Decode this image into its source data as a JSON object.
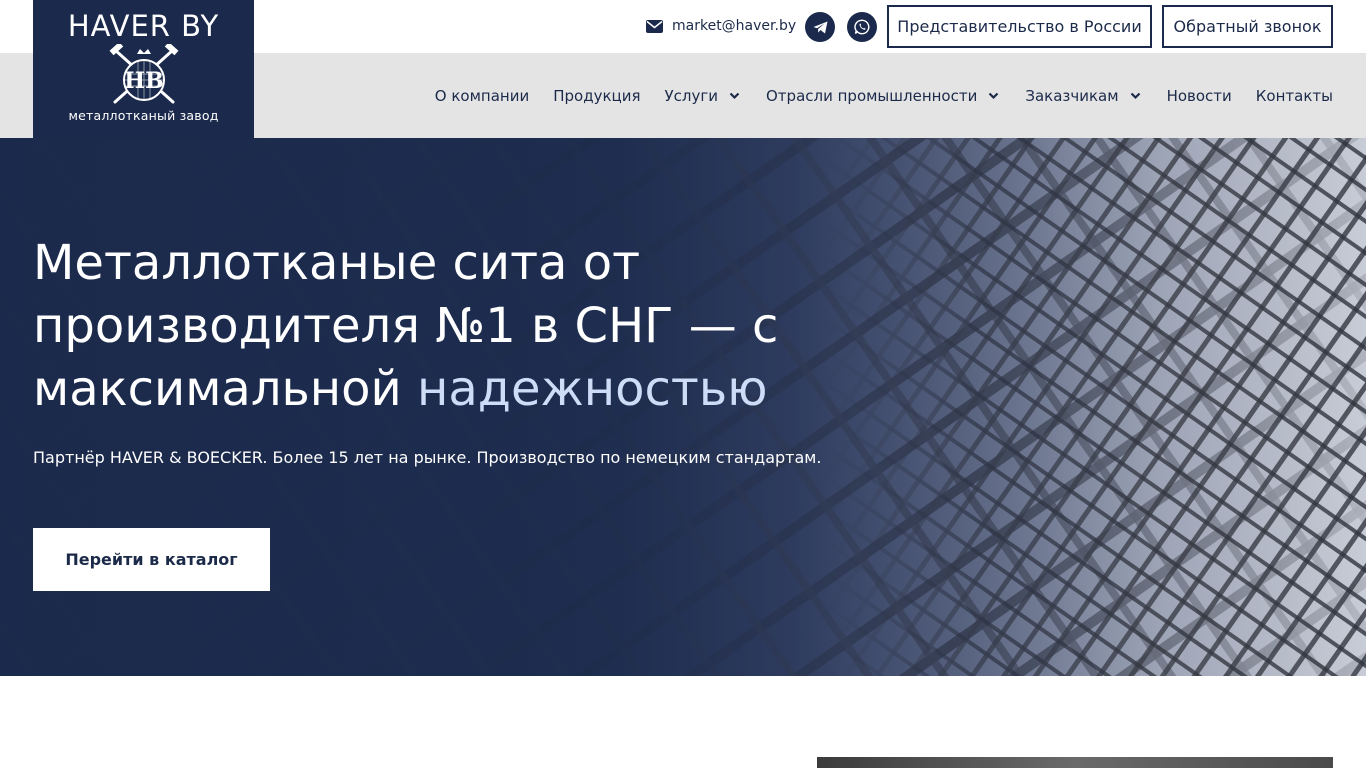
{
  "brand": {
    "title": "HAVER BY",
    "emblem_letters": "HB",
    "subtitle": "металлотканый завод",
    "color_primary": "#1b2a4c",
    "color_accent": "#cfdcf8"
  },
  "topbar": {
    "email": "market@haver.by",
    "email_icon": "envelope-icon",
    "social": [
      {
        "name": "telegram",
        "icon": "telegram-icon"
      },
      {
        "name": "whatsapp",
        "icon": "whatsapp-icon"
      }
    ],
    "russia_button": "Представительство в России",
    "callback_button": "Обратный звонок"
  },
  "menu": {
    "items": [
      {
        "label": "О компании",
        "has_dropdown": false
      },
      {
        "label": "Продукция",
        "has_dropdown": false
      },
      {
        "label": "Услуги",
        "has_dropdown": true
      },
      {
        "label": "Отрасли промышленности",
        "has_dropdown": true
      },
      {
        "label": "Заказчикам",
        "has_dropdown": true
      },
      {
        "label": "Новости",
        "has_dropdown": false
      },
      {
        "label": "Контакты",
        "has_dropdown": false
      }
    ]
  },
  "hero": {
    "title_line1": "Металлотканые сита от",
    "title_line2": "производителя №1 в СНГ — с",
    "title_line3_plain": "максимальной ",
    "title_line3_accent": "надежностью",
    "subtitle": "Партнёр HAVER & BOECKER. Более 15 лет на рынке. Производство по немецким стандартам.",
    "cta": "Перейти в каталог"
  }
}
